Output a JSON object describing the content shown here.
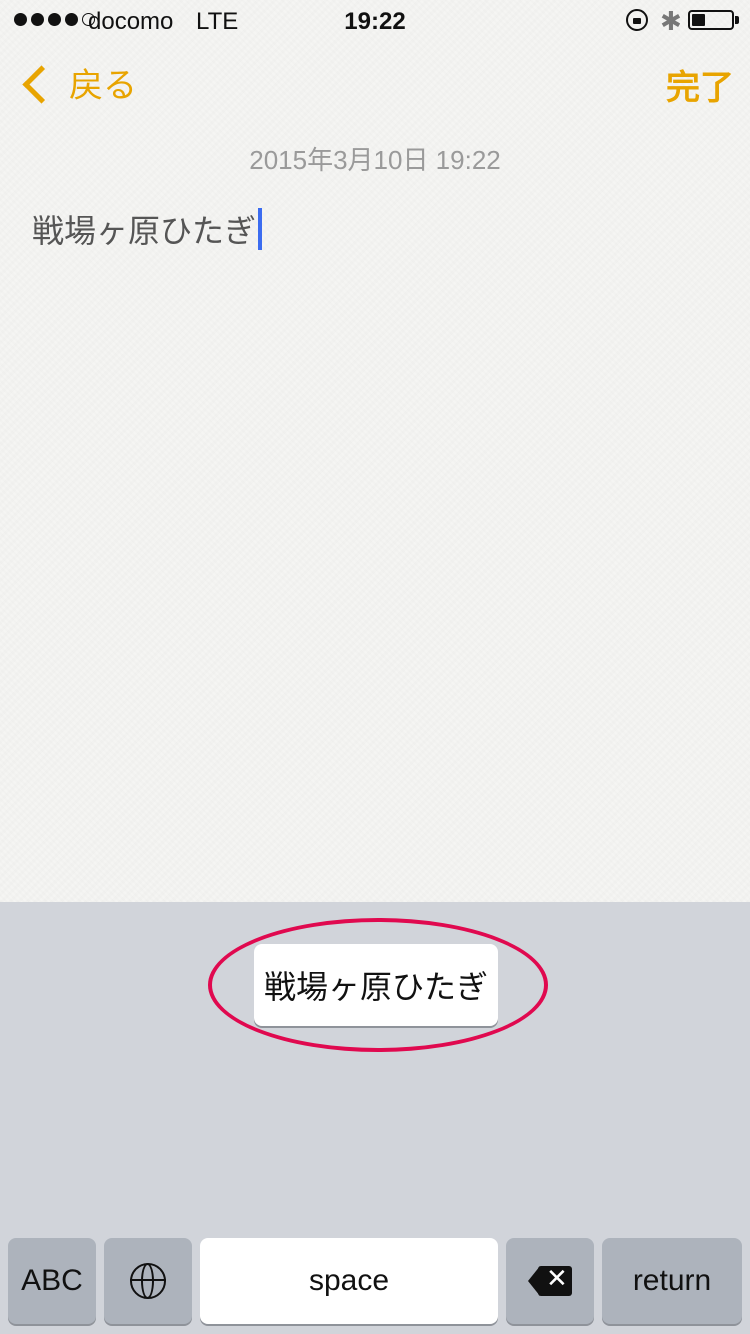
{
  "status": {
    "carrier": "docomo",
    "network": "LTE",
    "time": "19:22",
    "signal_bars": 4,
    "signal_max": 5,
    "battery_level": 0.35,
    "icons": [
      "rotation-lock-icon",
      "bluetooth-icon",
      "battery-icon"
    ]
  },
  "nav": {
    "back_label": "戻る",
    "done_label": "完了",
    "accent_color": "#e8a400"
  },
  "note": {
    "date": "2015年3月10日 19:22",
    "text": "戦場ヶ原ひたぎ"
  },
  "keyboard": {
    "candidate": "戦場ヶ原ひたぎ",
    "highlight_color": "#e0094f",
    "keys": {
      "abc": "ABC",
      "globe": "globe-icon",
      "space": "space",
      "delete": "delete-icon",
      "return": "return"
    }
  }
}
